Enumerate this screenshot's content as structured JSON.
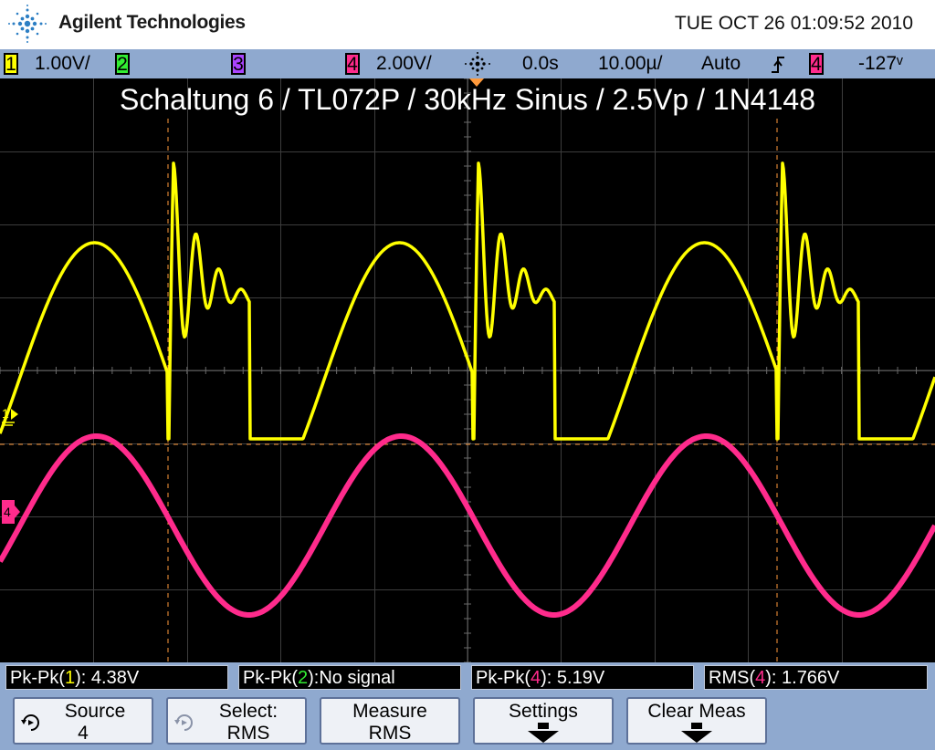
{
  "header": {
    "brand": "Agilent Technologies",
    "datetime": "TUE OCT 26 01:09:52 2010"
  },
  "status": {
    "ch1_num": "1",
    "ch1_scale": "1.00V/",
    "ch2_num": "2",
    "ch3_num": "3",
    "ch4_num": "4",
    "ch4_scale": "2.00V/",
    "delay": "0.0s",
    "timebase": "10.00µ/",
    "trigger_mode": "Auto",
    "trigger_slope_symbol": "≱",
    "trigger_source": "4",
    "trigger_level": "-127ᵛ"
  },
  "screen": {
    "annotation": "Schaltung 6 / TL072P / 30kHz Sinus / 2.5Vp / 1N4148",
    "ch1_marker": "1",
    "ch4_marker": "4"
  },
  "measurements": [
    {
      "prefix": "Pk-Pk(",
      "channel": "1",
      "suffix": "): 4.38V",
      "color_class": "c1"
    },
    {
      "prefix": "Pk-Pk(",
      "channel": "2",
      "suffix": "):No signal",
      "color_class": "c2"
    },
    {
      "prefix": "Pk-Pk(",
      "channel": "4",
      "suffix": "): 5.19V",
      "color_class": "c4"
    },
    {
      "prefix": "RMS(",
      "channel": "4",
      "suffix": "): 1.766V",
      "color_class": "c4"
    }
  ],
  "softkeys": {
    "source_line1": "Source",
    "source_line2": "4",
    "select_line1": "Select:",
    "select_line2": "RMS",
    "measure_line1": "Measure",
    "measure_line2": "RMS",
    "settings_line1": "Settings",
    "clear_line1": "Clear Meas"
  },
  "colors": {
    "ch1": "#ffff00",
    "ch2": "#33ee33",
    "ch3": "#aa44ff",
    "ch4": "#ff2b8c",
    "cursor": "#ff9a3c",
    "bar": "#8fa9cf"
  },
  "waveforms": {
    "ch4_frequency_khz": 30,
    "ch4_peak_to_peak_v": 5.19,
    "ch1_peak_to_peak_v": 4.38
  }
}
